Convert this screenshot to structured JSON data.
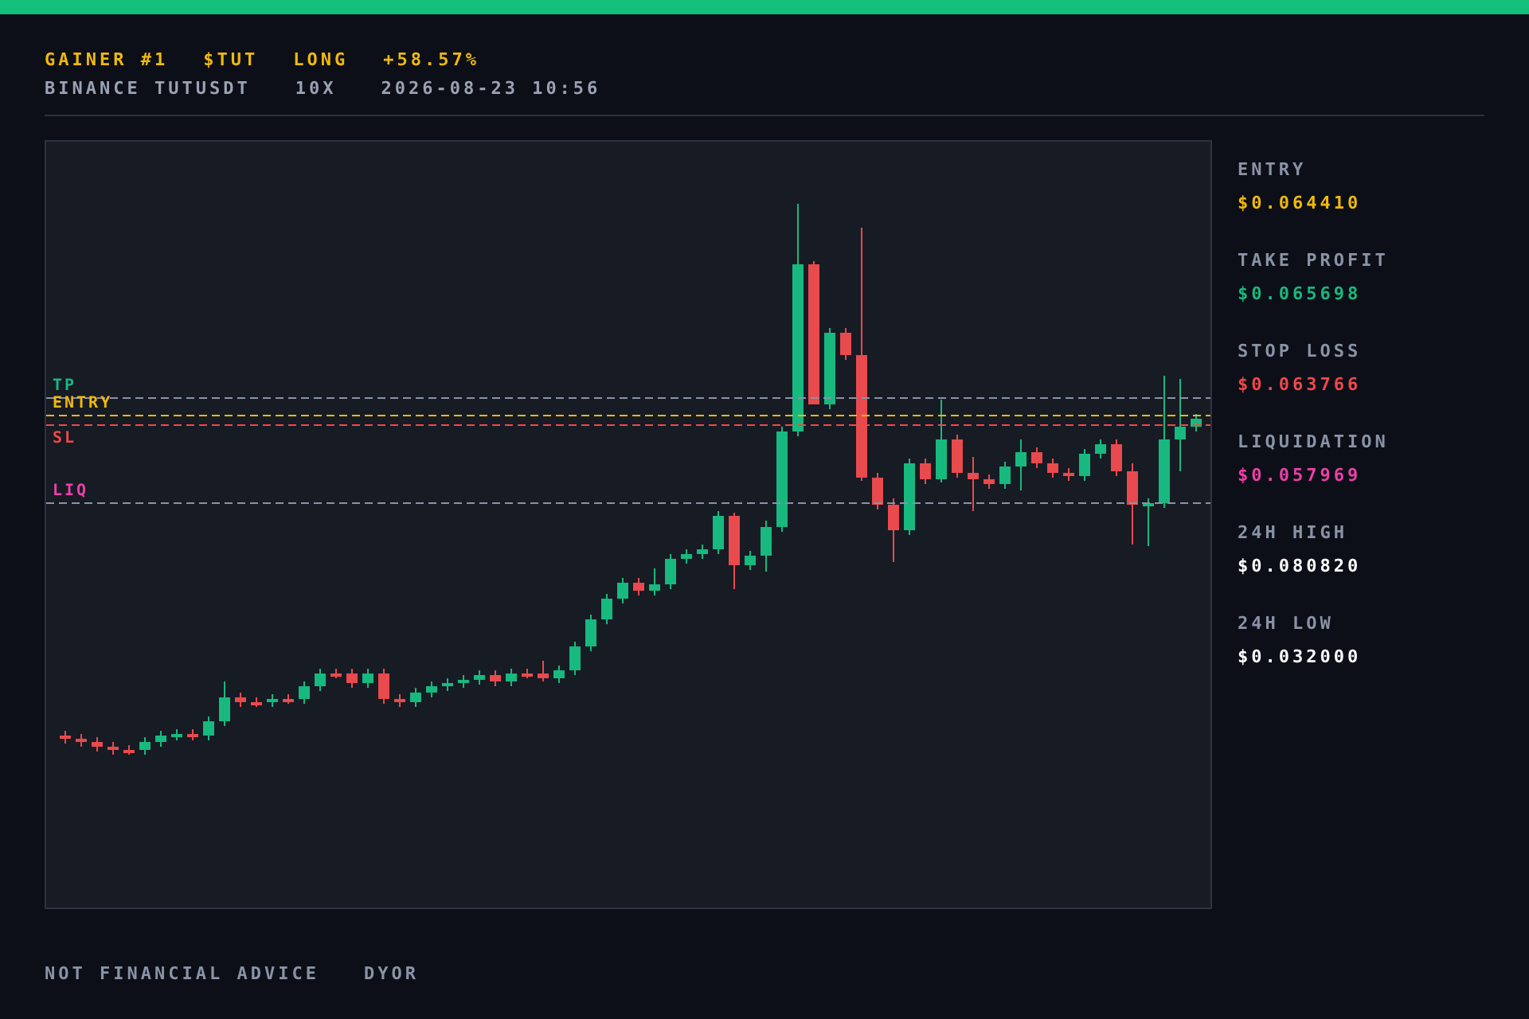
{
  "header": {
    "title": [
      "GAINER #1",
      "$TUT",
      "LONG",
      "+58.57%"
    ],
    "subtitle": [
      "BINANCE TUTUSDT",
      "10X",
      "2026-08-23 10:56"
    ]
  },
  "chart": {
    "levels": [
      {
        "kind": "tp",
        "label": "TP",
        "color": "#17b97f"
      },
      {
        "kind": "entry",
        "label": "ENTRY",
        "color": "#f0b90b"
      },
      {
        "kind": "sl",
        "label": "SL",
        "color": "#f0484b"
      },
      {
        "kind": "liq",
        "label": "LIQ",
        "color": "#ef3fa8"
      }
    ]
  },
  "stats": [
    {
      "label": "ENTRY",
      "value": "$0.064410",
      "color": "#f0b90b"
    },
    {
      "label": "TAKE PROFIT",
      "value": "$0.065698",
      "color": "#17b97f"
    },
    {
      "label": "STOP LOSS",
      "value": "$0.063766",
      "color": "#f0484b"
    },
    {
      "label": "LIQUIDATION",
      "value": "$0.057969",
      "color": "#ef3fa8"
    },
    {
      "label": "24H HIGH",
      "value": "$0.080820",
      "color": "#ffffff"
    },
    {
      "label": "24H LOW",
      "value": "$0.032000",
      "color": "#ffffff"
    }
  ],
  "footer": [
    "NOT FINANCIAL ADVICE",
    "DYOR"
  ]
}
